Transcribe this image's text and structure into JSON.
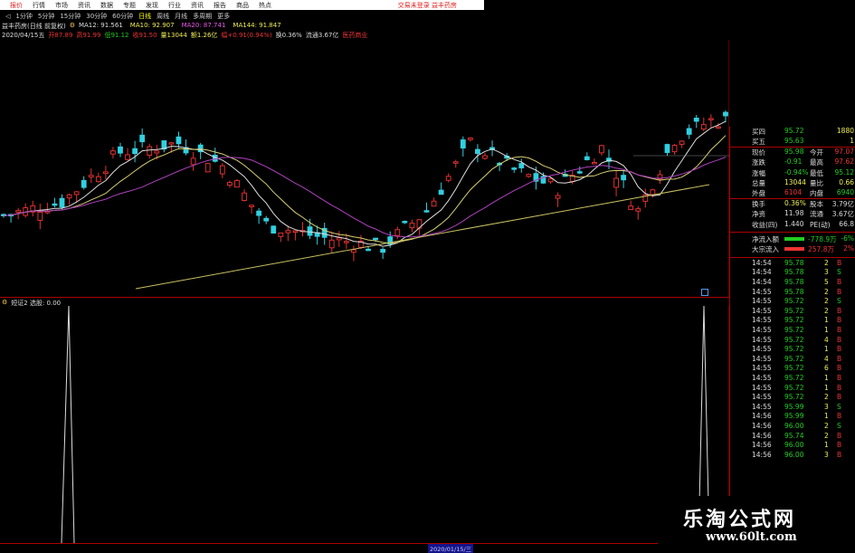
{
  "menu": {
    "items": [
      "报价",
      "行情",
      "市场",
      "资讯",
      "数据",
      "专题",
      "发现",
      "行业",
      "资讯",
      "报告",
      "商品",
      "热点"
    ],
    "active_index": 0,
    "account_text": "交易未登录  益丰药房"
  },
  "periods": [
    "1分钟",
    "5分钟",
    "15分钟",
    "30分钟",
    "60分钟",
    "日线",
    "周线",
    "月线",
    "多周期",
    "更多"
  ],
  "selected_period_index": 5,
  "main_info": {
    "stock": "益丰药房(日线 前复权)",
    "ma_parts": [
      {
        "text": "MA12: 91.561",
        "color": "c-white"
      },
      {
        "text": "MA10: 92.907",
        "color": "c-yellow"
      },
      {
        "text": "MA20: 87.741",
        "color": "c-mag"
      },
      {
        "text": "MA144: 91.847",
        "color": "c-yellow"
      }
    ]
  },
  "date_info": {
    "parts": [
      {
        "text": "2020/04/15五",
        "color": "c-white"
      },
      {
        "text": "开87.89",
        "color": "c-red"
      },
      {
        "text": "高91.99",
        "color": "c-red"
      },
      {
        "text": "低91.12",
        "color": "c-green"
      },
      {
        "text": "收91.50",
        "color": "c-red"
      },
      {
        "text": "量13044",
        "color": "c-yellow"
      },
      {
        "text": "额1.26亿",
        "color": "c-yellow"
      },
      {
        "text": "幅+0.91(0.94%)",
        "color": "c-red"
      },
      {
        "text": "换0.36%",
        "color": "c-white"
      },
      {
        "text": "流通3.67亿",
        "color": "c-white"
      },
      {
        "text": "医药商业",
        "color": "c-red"
      }
    ]
  },
  "indicator": {
    "label": "短证2 选股: 0.00"
  },
  "axis": {
    "bottom_date": "2020/01/15/三"
  },
  "quote": {
    "rows": [
      {
        "label": "买四",
        "value": "95.72",
        "extra": "1880",
        "vcolor": "c-green",
        "ecolor": "c-yellow"
      },
      {
        "label": "买五",
        "value": "95.63",
        "extra": "1",
        "vcolor": "c-green",
        "ecolor": "c-yellow"
      },
      {
        "label": "现价",
        "value": "95.98",
        "label2": "今开",
        "value2": "97.07",
        "vcolor": "c-green",
        "v2color": "c-red"
      },
      {
        "label": "涨跌",
        "value": "-0.91",
        "label2": "最高",
        "value2": "97.62",
        "vcolor": "c-green",
        "v2color": "c-red"
      },
      {
        "label": "涨幅",
        "value": "-0.94%",
        "label2": "最低",
        "value2": "95.12",
        "vcolor": "c-green",
        "v2color": "c-green"
      },
      {
        "label": "总量",
        "value": "13044",
        "label2": "量比",
        "value2": "0.66",
        "vcolor": "c-yellow",
        "v2color": "c-yellow"
      },
      {
        "label": "外盘",
        "value": "6104",
        "label2": "内盘",
        "value2": "6940",
        "vcolor": "c-red",
        "v2color": "c-green"
      },
      {
        "label": "换手",
        "value": "0.36%",
        "label2": "股本",
        "value2": "3.79亿",
        "vcolor": "c-yellow",
        "v2color": "c-white"
      },
      {
        "label": "净资",
        "value": "11.98",
        "label2": "流通",
        "value2": "3.67亿",
        "vcolor": "c-white",
        "v2color": "c-white"
      },
      {
        "label": "收益(四)",
        "value": "1.440",
        "label2": "PE(动)",
        "value2": "66.8",
        "vcolor": "c-white",
        "v2color": "c-white"
      }
    ],
    "flows": [
      {
        "label": "净流入额",
        "value": "-778.9万",
        "pct": "-6%",
        "color": "c-green"
      },
      {
        "label": "大宗流入",
        "value": "257.8万",
        "pct": "2%",
        "color": "c-red"
      }
    ]
  },
  "ticks": [
    {
      "time": "14:54",
      "price": "95.78",
      "vol": "2",
      "flag": "B",
      "pcolor": "c-green",
      "fcolor": "c-red"
    },
    {
      "time": "14:54",
      "price": "95.78",
      "vol": "3",
      "flag": "S",
      "pcolor": "c-green",
      "fcolor": "c-green"
    },
    {
      "time": "14:54",
      "price": "95.78",
      "vol": "5",
      "flag": "B",
      "pcolor": "c-green",
      "fcolor": "c-red"
    },
    {
      "time": "14:55",
      "price": "95.78",
      "vol": "2",
      "flag": "B",
      "pcolor": "c-green",
      "fcolor": "c-red"
    },
    {
      "time": "14:55",
      "price": "95.72",
      "vol": "2",
      "flag": "S",
      "pcolor": "c-green",
      "fcolor": "c-green"
    },
    {
      "time": "14:55",
      "price": "95.72",
      "vol": "2",
      "flag": "B",
      "pcolor": "c-green",
      "fcolor": "c-red"
    },
    {
      "time": "14:55",
      "price": "95.72",
      "vol": "1",
      "flag": "B",
      "pcolor": "c-green",
      "fcolor": "c-red"
    },
    {
      "time": "14:55",
      "price": "95.72",
      "vol": "1",
      "flag": "B",
      "pcolor": "c-green",
      "fcolor": "c-red"
    },
    {
      "time": "14:55",
      "price": "95.72",
      "vol": "4",
      "flag": "B",
      "pcolor": "c-green",
      "fcolor": "c-red"
    },
    {
      "time": "14:55",
      "price": "95.72",
      "vol": "1",
      "flag": "B",
      "pcolor": "c-green",
      "fcolor": "c-red"
    },
    {
      "time": "14:55",
      "price": "95.72",
      "vol": "4",
      "flag": "B",
      "pcolor": "c-green",
      "fcolor": "c-red"
    },
    {
      "time": "14:55",
      "price": "95.72",
      "vol": "6",
      "flag": "B",
      "pcolor": "c-green",
      "fcolor": "c-red"
    },
    {
      "time": "14:55",
      "price": "95.72",
      "vol": "1",
      "flag": "B",
      "pcolor": "c-green",
      "fcolor": "c-red"
    },
    {
      "time": "14:55",
      "price": "95.72",
      "vol": "1",
      "flag": "B",
      "pcolor": "c-green",
      "fcolor": "c-red"
    },
    {
      "time": "14:55",
      "price": "95.72",
      "vol": "2",
      "flag": "B",
      "pcolor": "c-green",
      "fcolor": "c-red"
    },
    {
      "time": "14:55",
      "price": "95.99",
      "vol": "3",
      "flag": "S",
      "pcolor": "c-green",
      "fcolor": "c-green"
    },
    {
      "time": "14:56",
      "price": "95.99",
      "vol": "1",
      "flag": "B",
      "pcolor": "c-green",
      "fcolor": "c-red"
    },
    {
      "time": "14:56",
      "price": "96.00",
      "vol": "2",
      "flag": "S",
      "pcolor": "c-green",
      "fcolor": "c-green"
    },
    {
      "time": "14:56",
      "price": "95.74",
      "vol": "2",
      "flag": "B",
      "pcolor": "c-green",
      "fcolor": "c-red"
    },
    {
      "time": "14:56",
      "price": "96.00",
      "vol": "1",
      "flag": "B",
      "pcolor": "c-green",
      "fcolor": "c-red"
    },
    {
      "time": "14:56",
      "price": "96.00",
      "vol": "3",
      "flag": "B",
      "pcolor": "c-green",
      "fcolor": "c-red"
    }
  ],
  "watermark": {
    "title": "乐淘公式网",
    "url": "www.60lt.com"
  },
  "colors": {
    "up": "#e03030",
    "down": "#30d0e0",
    "ma_white": "#dddddd",
    "ma_yellow": "#d8d070",
    "ma_magenta": "#b040c0",
    "ma_long": "#c8c060",
    "border": "#a00000"
  }
}
